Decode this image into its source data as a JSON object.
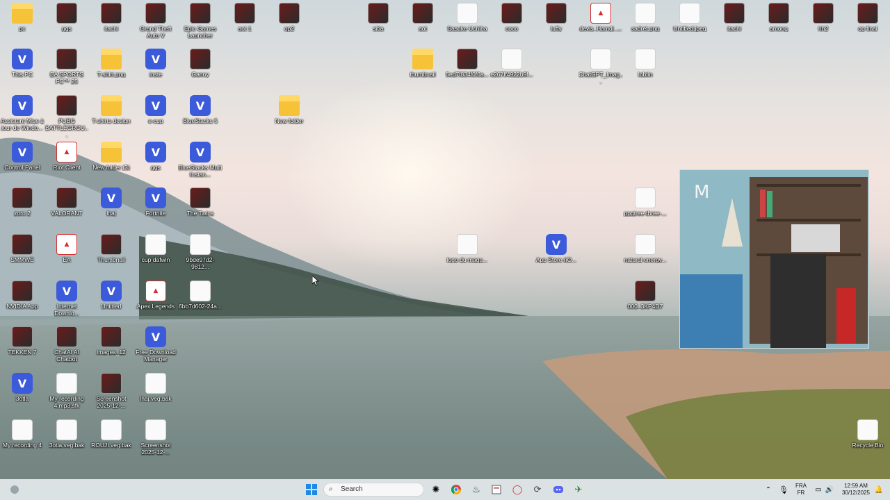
{
  "desktop": {
    "icons": [
      {
        "label": "pc",
        "icon": "folder-icon",
        "kind": "g-folder"
      },
      {
        "label": "ggs",
        "icon": "photo-icon",
        "kind": "g-photo"
      },
      {
        "label": "itachi",
        "icon": "photo-icon",
        "kind": "g-photo"
      },
      {
        "label": "Grand Theft Auto V",
        "icon": "gta-icon",
        "kind": "g-photo"
      },
      {
        "label": "Epic Games Launcher",
        "icon": "epic-games-icon",
        "kind": "g-photo"
      },
      {
        "label": "aot 1",
        "icon": "photo-icon",
        "kind": "g-photo"
      },
      {
        "label": "op2",
        "icon": "photo-icon",
        "kind": "g-photo"
      },
      {
        "label": "sitia",
        "icon": "photo-icon",
        "kind": "g-photo"
      },
      {
        "label": "aot",
        "icon": "photo-icon",
        "kind": "g-photo"
      },
      {
        "label": "Sasuke Uchiha",
        "icon": "photo-icon",
        "kind": "g-file"
      },
      {
        "label": "coco",
        "icon": "photo-icon",
        "kind": "g-photo"
      },
      {
        "label": "luffy",
        "icon": "photo-icon",
        "kind": "g-photo"
      },
      {
        "label": "devis_Hamdi_...",
        "icon": "pdf-icon",
        "kind": "g-pdf"
      },
      {
        "label": "sadret.png",
        "icon": "image-file-icon",
        "kind": "g-file"
      },
      {
        "label": "Untitled.jpeg",
        "icon": "image-file-icon",
        "kind": "g-file"
      },
      {
        "label": "itachi",
        "icon": "photo-icon",
        "kind": "g-photo"
      },
      {
        "label": "among",
        "icon": "photo-icon",
        "kind": "g-photo"
      },
      {
        "label": "hh2",
        "icon": "photo-icon",
        "kind": "g-photo"
      },
      {
        "label": "op final",
        "icon": "photo-icon",
        "kind": "g-photo"
      },
      {
        "label": "This PC",
        "icon": "monitor-icon",
        "kind": "g-v"
      },
      {
        "label": "EA SPORTS FC™ 25",
        "icon": "ea-fc-icon",
        "kind": "g-photo"
      },
      {
        "label": "T-shirt.png",
        "icon": "folder-icon",
        "kind": "g-folder"
      },
      {
        "label": "inste",
        "icon": "v-app-icon",
        "kind": "g-v"
      },
      {
        "label": "Ganny",
        "icon": "photo-icon",
        "kind": "g-photo"
      },
      {
        "label": "thumbnail",
        "icon": "folder-icon",
        "kind": "g-folder"
      },
      {
        "label": "5ed7f834f0f6a...",
        "icon": "photo-icon",
        "kind": "g-photo"
      },
      {
        "label": "e267ff4922b9f...",
        "icon": "photo-icon",
        "kind": "g-file"
      },
      {
        "label": "ChatGPT_Imag...",
        "icon": "image-file-icon",
        "kind": "g-file"
      },
      {
        "label": "Iobtin",
        "icon": "image-file-icon",
        "kind": "g-file"
      },
      {
        "label": "Assistant Mise à jour de Windo...",
        "icon": "windows-icon",
        "kind": "g-v"
      },
      {
        "label": "PUBG BATTLEGROU...",
        "icon": "pubg-icon",
        "kind": "g-photo"
      },
      {
        "label": "T-shirts design",
        "icon": "folder-icon",
        "kind": "g-folder"
      },
      {
        "label": "e-cup",
        "icon": "v-app-icon",
        "kind": "g-v"
      },
      {
        "label": "BlueStacks 5",
        "icon": "bluestacks-icon",
        "kind": "g-v"
      },
      {
        "label": "New folder",
        "icon": "folder-icon",
        "kind": "g-folder"
      },
      {
        "label": "Control Panel",
        "icon": "control-panel-icon",
        "kind": "g-v"
      },
      {
        "label": "Riot Client",
        "icon": "riot-icon",
        "kind": "g-pdf"
      },
      {
        "label": "New folder (3)",
        "icon": "folder-icon",
        "kind": "g-folder"
      },
      {
        "label": "ggs",
        "icon": "v-app-icon",
        "kind": "g-v"
      },
      {
        "label": "BlueStacks Multi Instan...",
        "icon": "bluestacks-multi-icon",
        "kind": "g-v"
      },
      {
        "label": "zoro 2",
        "icon": "photo-icon",
        "kind": "g-photo"
      },
      {
        "label": "VALORANT",
        "icon": "valorant-icon",
        "kind": "g-photo"
      },
      {
        "label": "lhaj",
        "icon": "v-app-icon",
        "kind": "g-v"
      },
      {
        "label": "Fortnite",
        "icon": "fortnite-icon",
        "kind": "g-v"
      },
      {
        "label": "The Twins",
        "icon": "photo-icon",
        "kind": "g-photo"
      },
      {
        "label": "ppgtree-three-...",
        "icon": "image-file-icon",
        "kind": "g-file"
      },
      {
        "label": "SMMWE",
        "icon": "game-icon",
        "kind": "g-photo"
      },
      {
        "label": "EA",
        "icon": "ea-icon",
        "kind": "g-pdf"
      },
      {
        "label": "Thumbnail",
        "icon": "image-file-icon",
        "kind": "g-photo"
      },
      {
        "label": "cup dafwin",
        "icon": "file-icon",
        "kind": "g-file"
      },
      {
        "label": "9bde97d2-9812...",
        "icon": "image-file-icon",
        "kind": "g-file"
      },
      {
        "label": "logo du maga...",
        "icon": "play-store-icon",
        "kind": "g-file"
      },
      {
        "label": "App Store (iO...",
        "icon": "app-store-icon",
        "kind": "g-v"
      },
      {
        "label": "natural energy...",
        "icon": "image-file-icon",
        "kind": "g-file"
      },
      {
        "label": "NVIDIA App",
        "icon": "nvidia-icon",
        "kind": "g-photo"
      },
      {
        "label": "Internet Downlo...",
        "icon": "idm-icon",
        "kind": "g-v"
      },
      {
        "label": "Untitled",
        "icon": "v-app-icon",
        "kind": "g-v"
      },
      {
        "label": "Apex Legends",
        "icon": "apex-icon",
        "kind": "g-pdf"
      },
      {
        "label": "6bb7d602-24a...",
        "icon": "image-file-icon",
        "kind": "g-file"
      },
      {
        "label": "000_3KP4D7",
        "icon": "photo-icon",
        "kind": "g-photo"
      },
      {
        "label": "TEKKEN 7",
        "icon": "tekken-icon",
        "kind": "g-photo"
      },
      {
        "label": "ChatAI AI Chatbot",
        "icon": "chatbot-icon",
        "kind": "g-photo"
      },
      {
        "label": "images_12",
        "icon": "photo-icon",
        "kind": "g-photo"
      },
      {
        "label": "Free Download Manager",
        "icon": "download-manager-icon",
        "kind": "g-v"
      },
      {
        "label": "3otla",
        "icon": "v-app-icon",
        "kind": "g-v"
      },
      {
        "label": "My recording 4.mp3.sfk",
        "icon": "file-icon",
        "kind": "g-file"
      },
      {
        "label": "Screenshot 2025-12-...",
        "icon": "photo-icon",
        "kind": "g-photo"
      },
      {
        "label": "lhaj.veg.bak",
        "icon": "file-icon",
        "kind": "g-file"
      },
      {
        "label": "My recording 4",
        "icon": "mp3-file-icon",
        "kind": "g-file"
      },
      {
        "label": "3otla.veg.bak",
        "icon": "file-icon",
        "kind": "g-file"
      },
      {
        "label": "ROUJI.veg.bak",
        "icon": "file-icon",
        "kind": "g-file"
      },
      {
        "label": "Screenshot 2025-12-...",
        "icon": "play-store-icon",
        "kind": "g-file"
      },
      {
        "label": "Recycle Bin",
        "icon": "recycle-bin-icon",
        "kind": "g-file"
      }
    ]
  },
  "taskbar": {
    "search_placeholder": "Search",
    "language_line1": "FRA",
    "language_line2": "FR",
    "time": "12:59 AM",
    "date": "30/12/2025"
  }
}
